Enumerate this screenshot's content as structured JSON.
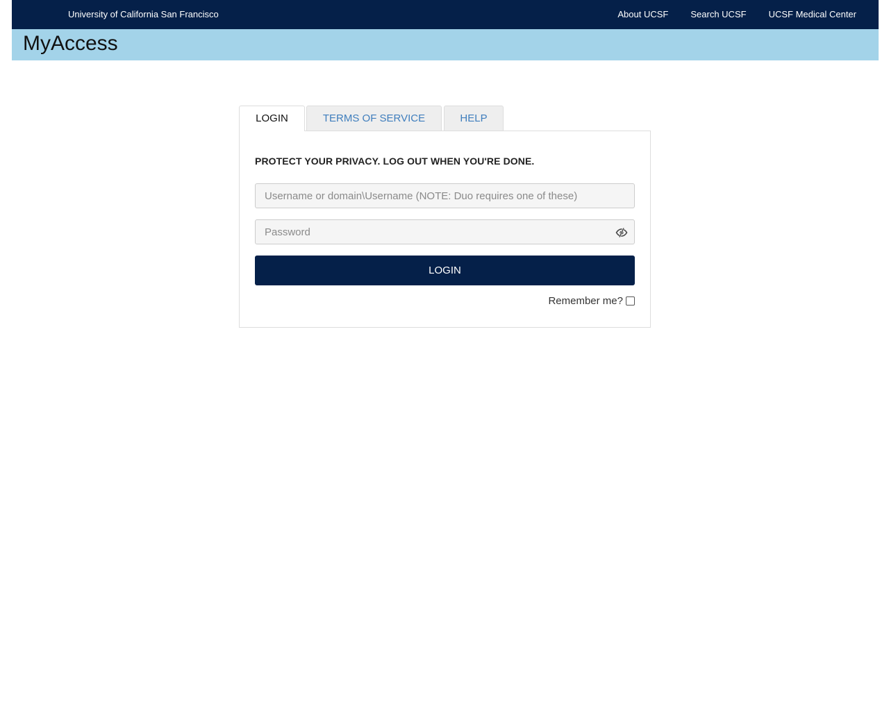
{
  "header": {
    "university": "University of California San Francisco",
    "links": [
      "About UCSF",
      "Search UCSF",
      "UCSF Medical Center"
    ]
  },
  "app": {
    "title": "MyAccess"
  },
  "tabs": [
    {
      "label": "LOGIN",
      "active": true
    },
    {
      "label": "TERMS OF SERVICE",
      "active": false
    },
    {
      "label": "HELP",
      "active": false
    }
  ],
  "login": {
    "notice": "PROTECT YOUR PRIVACY. LOG OUT WHEN YOU'RE DONE.",
    "username_placeholder": "Username or domain\\Username (NOTE: Duo requires one of these)",
    "username_value": "",
    "password_placeholder": "Password",
    "password_value": "",
    "password_toggle_icon": "eye-slash-icon",
    "button_label": "LOGIN",
    "remember_label": "Remember me?",
    "remember_checked": false
  },
  "colors": {
    "brand_navy": "#052049",
    "title_band": "#a3d3e9",
    "tab_link": "#3f7ebd"
  }
}
